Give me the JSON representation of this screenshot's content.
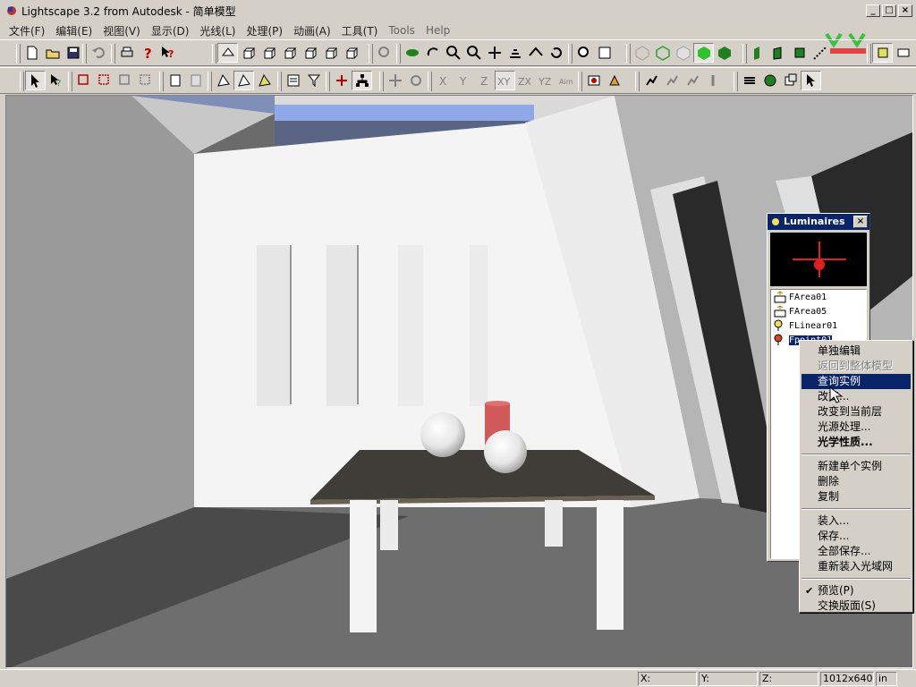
{
  "window": {
    "title": "Lightscape 3.2 from Autodesk - 简单模型",
    "min": "_",
    "max": "□",
    "close": "×"
  },
  "menu": [
    "文件(F)",
    "编辑(E)",
    "视图(V)",
    "显示(D)",
    "光线(L)",
    "处理(P)",
    "动画(A)",
    "工具(T)",
    "Tools",
    "Help"
  ],
  "luminaires": {
    "title": "Luminaires",
    "close": "×",
    "items": [
      {
        "label": "FArea01",
        "icon": "area-light-icon"
      },
      {
        "label": "FArea05",
        "icon": "area-light-icon"
      },
      {
        "label": "FLinear01",
        "icon": "linear-light-icon"
      },
      {
        "label": "Fpoint01",
        "icon": "point-light-icon"
      }
    ]
  },
  "context_menu": {
    "g1": [
      "单独编辑",
      "返回到整体模型",
      "查询实例",
      "改变...",
      "改变到当前层",
      "光源处理...",
      "光学性质..."
    ],
    "g2": [
      "新建单个实例",
      "删除",
      "复制"
    ],
    "g3": [
      "装入...",
      "保存...",
      "全部保存...",
      "重新装入光域网"
    ],
    "g4": [
      "预览(P)",
      "交换版面(S)"
    ],
    "disabled": "返回到整体模型",
    "highlighted": "查询实例",
    "checked": "预览(P)"
  },
  "status": {
    "x": "X:",
    "y": "Y:",
    "z": "Z:",
    "size": "1012x640",
    "unit": "in"
  },
  "colors": {
    "menu_highlight": "#0a246a",
    "face": "#d4d0c8",
    "accent_green": "#1e9e1e",
    "red": "#cc2222"
  }
}
